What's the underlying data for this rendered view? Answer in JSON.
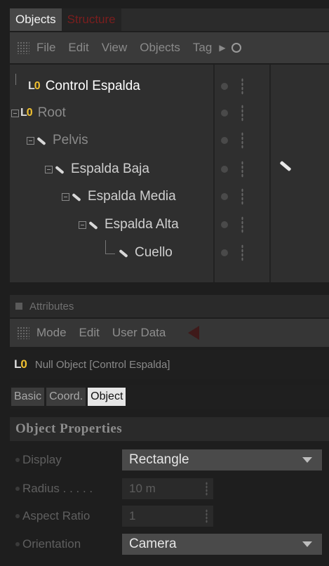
{
  "tabs": [
    "Objects",
    "Structure"
  ],
  "menu": [
    "File",
    "Edit",
    "View",
    "Objects",
    "Tag"
  ],
  "tree": {
    "rows": [
      {
        "label": "Control Espalda",
        "type": "null"
      },
      {
        "label": "Root",
        "type": "null"
      },
      {
        "label": "Pelvis",
        "type": "bone"
      },
      {
        "label": "Espalda Baja",
        "type": "bone"
      },
      {
        "label": "Espalda Media",
        "type": "bone"
      },
      {
        "label": "Espalda Alta",
        "type": "bone"
      },
      {
        "label": "Cuello",
        "type": "bone"
      }
    ]
  },
  "attributes": {
    "header": "Attributes",
    "menu": [
      "Mode",
      "Edit",
      "User Data"
    ],
    "object_title": "Null Object [Control Espalda]",
    "subtabs": [
      "Basic",
      "Coord.",
      "Object"
    ],
    "section": "Object Properties",
    "props": {
      "display": {
        "label": "Display",
        "value": "Rectangle"
      },
      "radius": {
        "label": "Radius . . . . .",
        "value": "10 m"
      },
      "aspect": {
        "label": "Aspect Ratio",
        "value": "1"
      },
      "orientation": {
        "label": "Orientation",
        "value": "Camera"
      }
    }
  },
  "icons": {
    "null_icon": "L0",
    "accent": "#f0c030"
  }
}
